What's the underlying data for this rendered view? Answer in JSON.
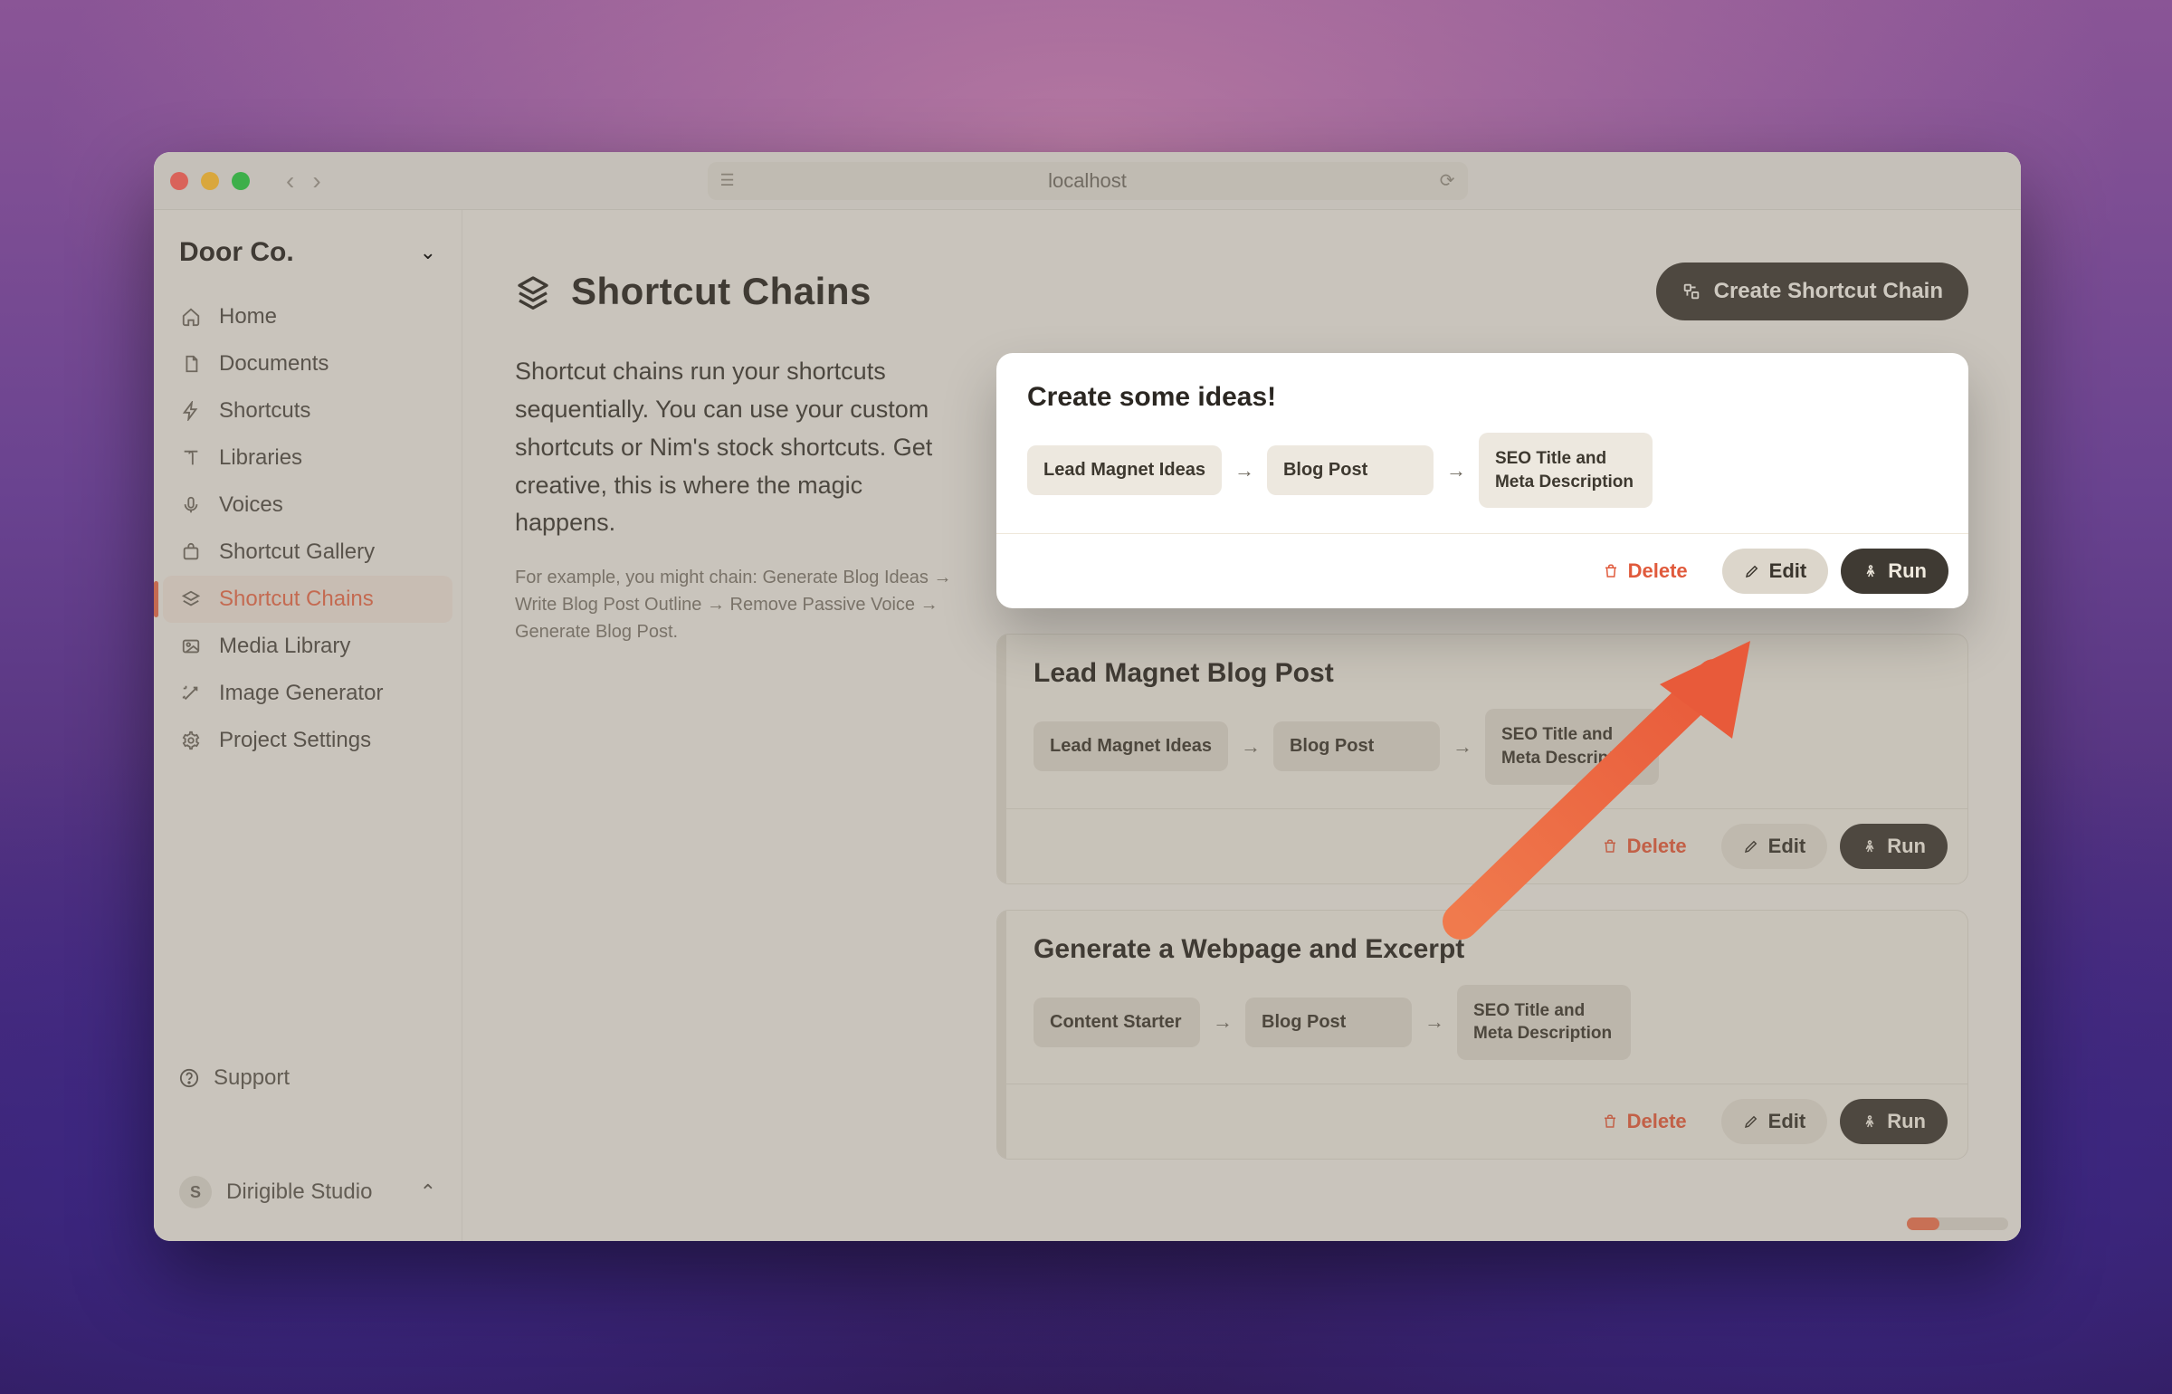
{
  "browser": {
    "url": "localhost"
  },
  "sidebar": {
    "org_name": "Door Co.",
    "items": [
      {
        "label": "Home",
        "icon": "home"
      },
      {
        "label": "Documents",
        "icon": "document"
      },
      {
        "label": "Shortcuts",
        "icon": "bolt"
      },
      {
        "label": "Libraries",
        "icon": "book"
      },
      {
        "label": "Voices",
        "icon": "mic"
      },
      {
        "label": "Shortcut Gallery",
        "icon": "bag"
      },
      {
        "label": "Shortcut Chains",
        "icon": "layers",
        "active": true
      },
      {
        "label": "Media Library",
        "icon": "image"
      },
      {
        "label": "Image Generator",
        "icon": "wand"
      },
      {
        "label": "Project Settings",
        "icon": "gear"
      }
    ],
    "support_label": "Support",
    "account": {
      "initial": "S",
      "name": "Dirigible Studio"
    }
  },
  "page": {
    "title": "Shortcut Chains",
    "create_button": "Create Shortcut Chain",
    "intro": "Shortcut chains run your shortcuts sequentially. You can use your custom shortcuts or Nim's stock shortcuts. Get creative, this is where the magic happens.",
    "example": "For example, you might chain: Generate Blog Ideas → Write Blog Post Outline → Remove Passive Voice → Generate Blog Post."
  },
  "chains": [
    {
      "title": "Create some ideas!",
      "steps": [
        "Lead Magnet Ideas",
        "Blog Post",
        "SEO Title and Meta Description"
      ],
      "highlighted": true
    },
    {
      "title": "Lead Magnet Blog Post",
      "steps": [
        "Lead Magnet Ideas",
        "Blog Post",
        "SEO Title and Meta Description"
      ]
    },
    {
      "title": "Generate a Webpage and Excerpt",
      "steps": [
        "Content Starter",
        "Blog Post",
        "SEO Title and Meta Description"
      ]
    }
  ],
  "actions": {
    "delete": "Delete",
    "edit": "Edit",
    "run": "Run"
  },
  "colors": {
    "accent": "#e2694a",
    "card_dark": "#3f3a33"
  }
}
